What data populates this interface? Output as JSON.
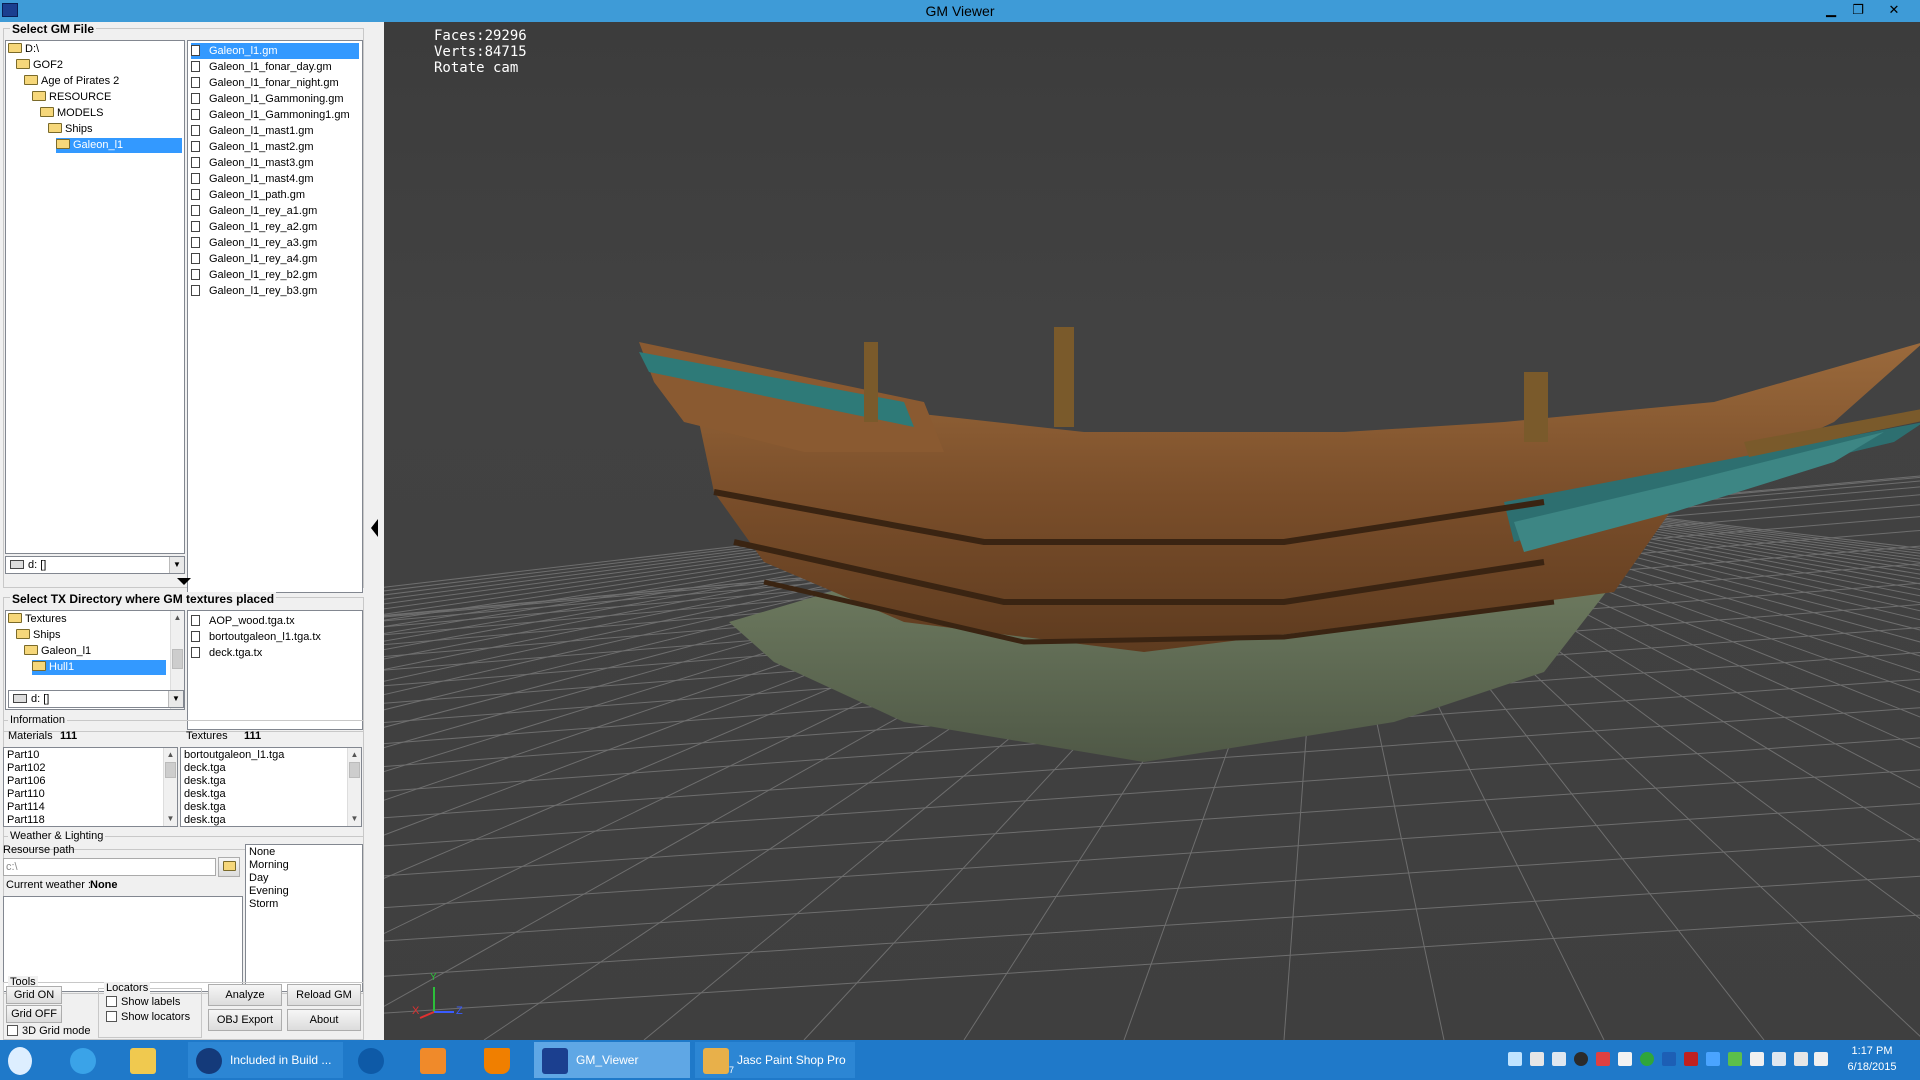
{
  "window": {
    "title": "GM Viewer"
  },
  "gm_file": {
    "group_label": "Select GM File",
    "tree": [
      {
        "label": "D:\\",
        "indent": 0
      },
      {
        "label": "GOF2",
        "indent": 1
      },
      {
        "label": "Age of Pirates 2",
        "indent": 2
      },
      {
        "label": "RESOURCE",
        "indent": 3
      },
      {
        "label": "MODELS",
        "indent": 4
      },
      {
        "label": "Ships",
        "indent": 5
      },
      {
        "label": "Galeon_l1",
        "indent": 6,
        "selected": true
      }
    ],
    "files": [
      "Galeon_l1.gm",
      "Galeon_l1_fonar_day.gm",
      "Galeon_l1_fonar_night.gm",
      "Galeon_l1_Gammoning.gm",
      "Galeon_l1_Gammoning1.gm",
      "Galeon_l1_mast1.gm",
      "Galeon_l1_mast2.gm",
      "Galeon_l1_mast3.gm",
      "Galeon_l1_mast4.gm",
      "Galeon_l1_path.gm",
      "Galeon_l1_rey_a1.gm",
      "Galeon_l1_rey_a2.gm",
      "Galeon_l1_rey_a3.gm",
      "Galeon_l1_rey_a4.gm",
      "Galeon_l1_rey_b2.gm",
      "Galeon_l1_rey_b3.gm"
    ],
    "selected_file": 0,
    "drive": "d: []"
  },
  "tx_dir": {
    "group_label": "Select TX Directory where GM textures placed",
    "tree": [
      {
        "label": "Textures",
        "indent": 1
      },
      {
        "label": "Ships",
        "indent": 2
      },
      {
        "label": "Galeon_l1",
        "indent": 3
      },
      {
        "label": "Hull1",
        "indent": 4,
        "selected": true
      }
    ],
    "files": [
      "AOP_wood.tga.tx",
      "bortoutgaleon_l1.tga.tx",
      "deck.tga.tx"
    ],
    "drive": "d: []"
  },
  "information": {
    "group_label": "Information",
    "materials_label": "Materials",
    "materials_count": "111",
    "textures_label": "Textures",
    "textures_count": "111",
    "materials": [
      "Part10",
      "Part102",
      "Part106",
      "Part110",
      "Part114",
      "Part118"
    ],
    "textures": [
      "bortoutgaleon_l1.tga",
      "deck.tga",
      "desk.tga",
      "desk.tga",
      "desk.tga",
      "desk.tga"
    ]
  },
  "weather": {
    "group_label": "Weather & Lighting",
    "resource_path_label": "Resourse path",
    "resource_path_value": "c:\\",
    "current_label": "Current weather :",
    "current_value": "None",
    "options": [
      "None",
      "Morning",
      "Day",
      "Evening",
      "Storm"
    ]
  },
  "tools": {
    "group_label": "Tools",
    "grid_on": "Grid ON",
    "grid_off": "Grid OFF",
    "grid_3d": "3D Grid mode",
    "locators_label": "Locators",
    "show_labels": "Show labels",
    "show_locators": "Show locators",
    "analyze": "Analyze",
    "reload": "Reload GM",
    "obj_export": "OBJ Export",
    "about": "About"
  },
  "viewport": {
    "faces": "Faces:29296",
    "verts": "Verts:84715",
    "mode": "Rotate cam",
    "axis_x": "X",
    "axis_y": "Y",
    "axis_z": "Z"
  },
  "taskbar": {
    "items": [
      "Included in Build ...",
      "GM_Viewer",
      "Jasc Paint Shop Pro"
    ],
    "badge": "7",
    "time": "1:17 PM",
    "date": "6/18/2015"
  },
  "colors": {
    "titlebar": "#3e9bd7",
    "selection": "#3399ff",
    "taskbar": "#1f79c9",
    "viewport_bg": "#404040"
  }
}
